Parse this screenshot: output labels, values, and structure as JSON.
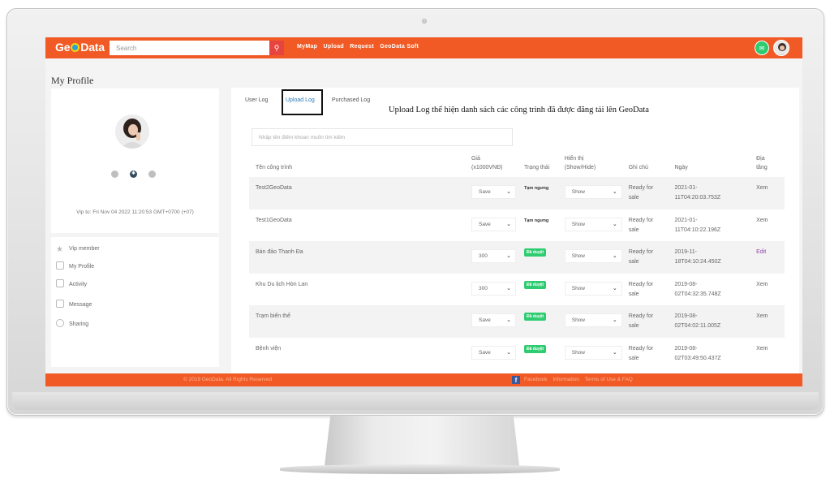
{
  "app": {
    "logo_text_before": "Ge",
    "logo_text_after": "Data"
  },
  "topbar": {
    "search_placeholder": "Search",
    "nav": [
      "MyMap",
      "Upload",
      "Request",
      "GeoData Soft"
    ]
  },
  "page_title": "My Profile",
  "profile": {
    "vip_text": "Vip to: Fri Nov 04 2022 11:20:53 GMT+0700 (+07)"
  },
  "side_menu": [
    {
      "label": "Vip member",
      "icon": "star-icon"
    },
    {
      "label": "My Profile",
      "icon": "profile-icon"
    },
    {
      "label": "Activity",
      "icon": "activity-icon"
    },
    {
      "label": "Message",
      "icon": "message-icon"
    },
    {
      "label": "Sharing",
      "icon": "sharing-icon"
    }
  ],
  "tabs": [
    {
      "label": "User Log",
      "active": false
    },
    {
      "label": "Upload Log",
      "active": true
    },
    {
      "label": "Purchased Log",
      "active": false
    }
  ],
  "caption": "Upload Log thể hiện danh sách các công trình đã được đăng tải lên GeoData",
  "filter_placeholder": "Nhập tên điểm khoan muốn tìm kiếm",
  "table": {
    "headers": {
      "name": "Tên công trình",
      "price_line1": "Giá",
      "price_line2": "(x1000VNĐ)",
      "status": "Trạng thái",
      "visibility_line1": "Hiển thị",
      "visibility_line2": "(Show/Hide)",
      "note": "Ghi chú",
      "date": "Ngày",
      "layer_line1": "Địa",
      "layer_line2": "tầng"
    },
    "rows": [
      {
        "name": "Test2GeoData",
        "price": "Save",
        "status": "Tạm ngưng",
        "status_type": "text",
        "visibility": "Show",
        "note_line1": "Ready for",
        "note_line2": "sale",
        "date_line1": "2021-01-",
        "date_line2": "11T04:20:03.753Z",
        "action": "Xem"
      },
      {
        "name": "Test1GeoData",
        "price": "Save",
        "status": "Tạm ngưng",
        "status_type": "text",
        "visibility": "Show",
        "note_line1": "Ready for",
        "note_line2": "sale",
        "date_line1": "2021-01-",
        "date_line2": "11T04:10:22.196Z",
        "action": "Xem"
      },
      {
        "name": "Bán đảo Thanh Đa",
        "price": "300",
        "status": "Đã duyệt",
        "status_type": "badge",
        "visibility": "Show",
        "note_line1": "Ready for",
        "note_line2": "sale",
        "date_line1": "2019-11-",
        "date_line2": "18T04:10:24.450Z",
        "action": "Edit"
      },
      {
        "name": "Khu Du lịch Hòn Lan",
        "price": "300",
        "status": "Đã duyệt",
        "status_type": "badge",
        "visibility": "Show",
        "note_line1": "Ready for",
        "note_line2": "sale",
        "date_line1": "2019-08-",
        "date_line2": "02T04:32:35.748Z",
        "action": "Xem"
      },
      {
        "name": "Trạm biến thế",
        "price": "Save",
        "status": "Đã duyệt",
        "status_type": "badge",
        "visibility": "Show",
        "note_line1": "Ready for",
        "note_line2": "sale",
        "date_line1": "2019-08-",
        "date_line2": "02T04:02:11.005Z",
        "action": "Xem"
      },
      {
        "name": "Bệnh viện",
        "price": "Save",
        "status": "Đã duyệt",
        "status_type": "badge",
        "visibility": "Show",
        "note_line1": "Ready for",
        "note_line2": "sale",
        "date_line1": "2019-08-",
        "date_line2": "02T03:49:50.437Z",
        "action": "Xem"
      }
    ]
  },
  "footer": {
    "copyright": "© 2019 GeoData. All Rights Reserved",
    "links": [
      "Facebook",
      "Information",
      "Terms of Use & FAQ"
    ]
  },
  "colors": {
    "brand_orange": "#f15a24",
    "badge_green": "#2ecc71",
    "active_tab": "#2a7ab8",
    "edit_purple": "#8e44ad"
  }
}
